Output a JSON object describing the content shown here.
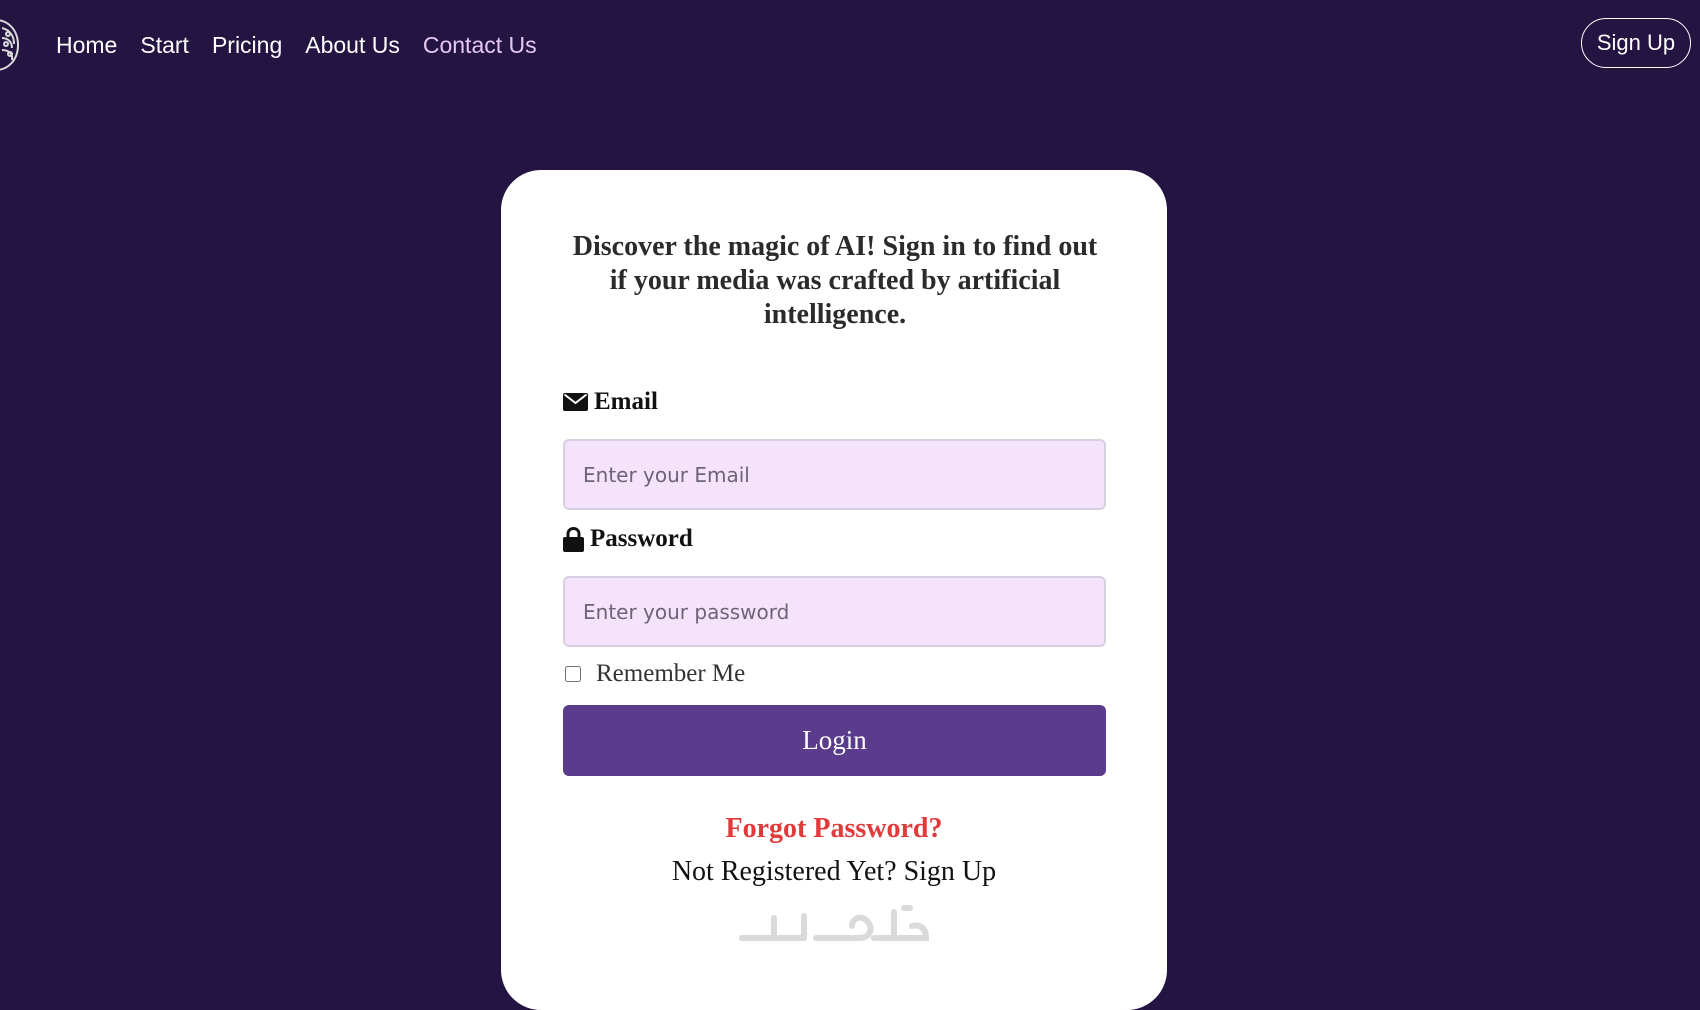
{
  "nav": {
    "links": [
      "Home",
      "Start",
      "Pricing",
      "About Us",
      "Contact Us"
    ],
    "signup_label": "Sign Up"
  },
  "login_card": {
    "heading": "Discover the magic of AI! Sign in to find out if your media was crafted by artificial intelligence.",
    "email_label": "Email",
    "email_placeholder": "Enter your Email",
    "email_value": "",
    "password_label": "Password",
    "password_placeholder": "Enter your password",
    "password_value": "",
    "remember_label": "Remember Me",
    "remember_checked": false,
    "login_label": "Login",
    "forgot_label": "Forgot Password?",
    "not_registered": "Not Registered Yet? Sign Up",
    "watermark": "خمسات"
  },
  "icons": {
    "logo": "brain-logo-icon",
    "email": "envelope-icon",
    "password": "lock-icon"
  },
  "colors": {
    "background": "#231441",
    "accent": "#5b3b8c",
    "input_fill": "#f5e2fc",
    "forgot_link": "#e23a3a",
    "contact_link": "#e6c7f2"
  }
}
